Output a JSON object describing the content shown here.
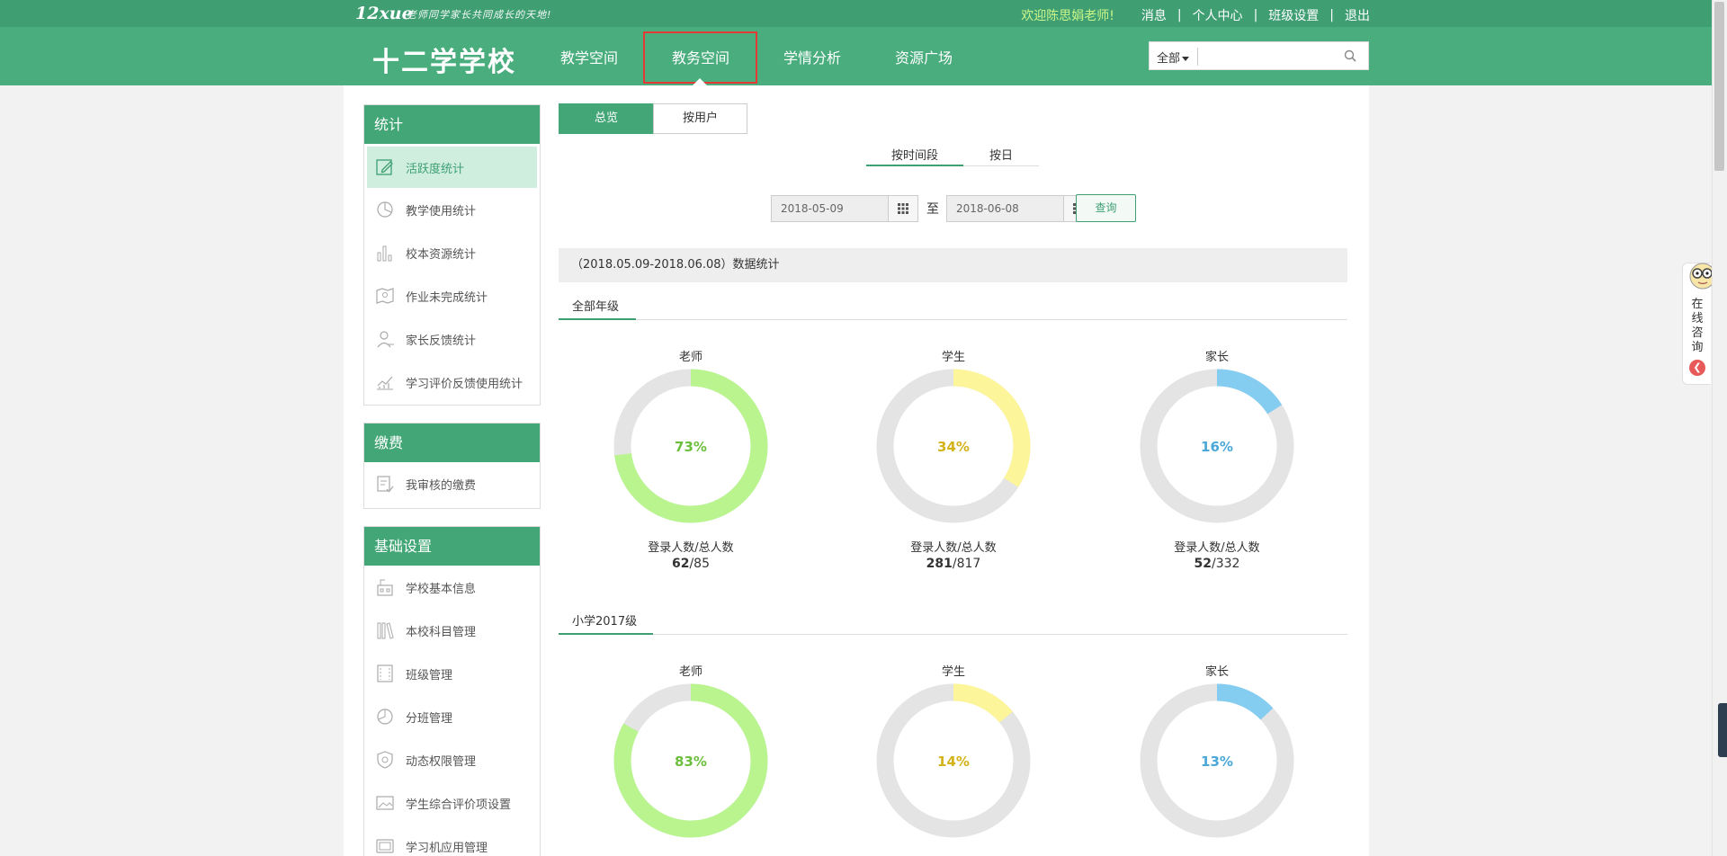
{
  "topbar": {
    "logo": "12xue",
    "slogan": "老师同学家长共同成长的天地!",
    "welcome": "欢迎陈思娟老师!",
    "links": [
      "消息",
      "个人中心",
      "班级设置",
      "退出"
    ],
    "separator": "|"
  },
  "navbar": {
    "school_name": "十二学学校",
    "items": [
      "教学空间",
      "教务空间",
      "学情分析",
      "资源广场"
    ],
    "active_index": 1,
    "search": {
      "scope": "全部",
      "placeholder": ""
    }
  },
  "sidebar": {
    "sections": [
      {
        "title": "统计",
        "items": [
          {
            "label": "活跃度统计",
            "icon": "edit-icon",
            "active": true
          },
          {
            "label": "教学使用统计",
            "icon": "pie-chart-icon"
          },
          {
            "label": "校本资源统计",
            "icon": "bar-chart-icon"
          },
          {
            "label": "作业未完成统计",
            "icon": "map-icon"
          },
          {
            "label": "家长反馈统计",
            "icon": "user-icon"
          },
          {
            "label": "学习评价反馈使用统计",
            "icon": "line-chart-icon"
          }
        ]
      },
      {
        "title": "缴费",
        "items": [
          {
            "label": "我审核的缴费",
            "icon": "audit-icon"
          }
        ]
      },
      {
        "title": "基础设置",
        "items": [
          {
            "label": "学校基本信息",
            "icon": "school-icon"
          },
          {
            "label": "本校科目管理",
            "icon": "books-icon"
          },
          {
            "label": "班级管理",
            "icon": "class-icon"
          },
          {
            "label": "分班管理",
            "icon": "split-icon"
          },
          {
            "label": "动态权限管理",
            "icon": "shield-icon"
          },
          {
            "label": "学生综合评价项设置",
            "icon": "image-icon"
          },
          {
            "label": "学习机应用管理",
            "icon": "tablet-icon"
          }
        ]
      }
    ]
  },
  "main": {
    "view_tabs": [
      "总览",
      "按用户"
    ],
    "view_active": 0,
    "range_tabs": [
      "按时间段",
      "按日"
    ],
    "range_active": 0,
    "date_from": "2018-05-09",
    "date_to": "2018-06-08",
    "to_label": "至",
    "query_label": "查询",
    "stat_title": "（2018.05.09-2018.06.08）数据统计",
    "caption": "登录人数/总人数",
    "sections": [
      {
        "title": "全部年级",
        "donuts": [
          {
            "role": "老师",
            "percent": 73,
            "percent_label": "73%",
            "logged": "62",
            "total": "/85",
            "color": "#b9f48f",
            "text_color": "#6cbf3c"
          },
          {
            "role": "学生",
            "percent": 34,
            "percent_label": "34%",
            "logged": "281",
            "total": "/817",
            "color": "#fdf59a",
            "text_color": "#d4b21a"
          },
          {
            "role": "家长",
            "percent": 16,
            "percent_label": "16%",
            "logged": "52",
            "total": "/332",
            "color": "#84cdf1",
            "text_color": "#4aa8d8"
          }
        ]
      },
      {
        "title": "小学2017级",
        "donuts": [
          {
            "role": "老师",
            "percent": 83,
            "percent_label": "83%",
            "color": "#b9f48f",
            "text_color": "#6cbf3c"
          },
          {
            "role": "学生",
            "percent": 14,
            "percent_label": "14%",
            "color": "#fdf59a",
            "text_color": "#d4b21a"
          },
          {
            "role": "家长",
            "percent": 13,
            "percent_label": "13%",
            "color": "#84cdf1",
            "text_color": "#4aa8d8"
          }
        ]
      }
    ]
  },
  "consult": {
    "label": "在线咨询"
  },
  "colors": {
    "brand": "#4aad7e",
    "brand_dark": "#3f9f73",
    "ring_bg": "#e4e4e4"
  }
}
